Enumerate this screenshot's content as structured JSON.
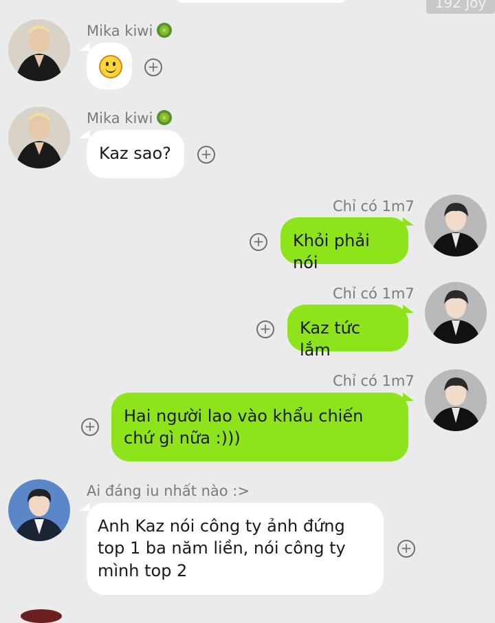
{
  "top_badge": "192 Joy",
  "messages": [
    {
      "sender": "Mika kiwi",
      "text": "",
      "emoji": "slightly-smiling-face"
    },
    {
      "sender": "Mika kiwi",
      "text": "Kaz sao?"
    },
    {
      "sender": "Chỉ có 1m7",
      "text": "Khỏi phải nói"
    },
    {
      "sender": "Chỉ có 1m7",
      "text": "Kaz tức lắm"
    },
    {
      "sender": "Chỉ có 1m7",
      "text": "Hai người lao vào khẩu chiến chứ gì nữa :)))"
    },
    {
      "sender": "Ai đáng iu nhất nào :>",
      "text": "Anh Kaz nói công ty ảnh đứng top 1 ba năm liền, nói công ty mình top 2"
    }
  ],
  "colors": {
    "background": "#ebebeb",
    "incoming_bubble": "#ffffff",
    "outgoing_bubble": "#8ee41a",
    "sender_text": "#7a7a7a"
  },
  "icons": {
    "plus": "add-reaction-icon",
    "kiwi": "kiwi-icon"
  }
}
